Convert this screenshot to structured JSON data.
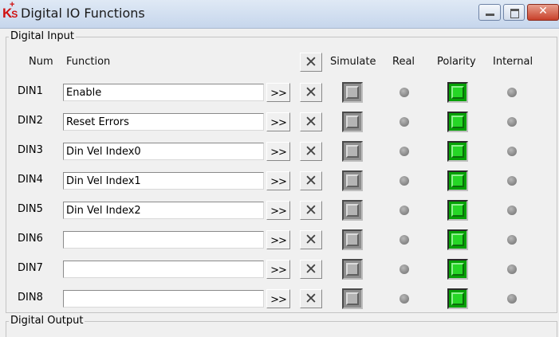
{
  "window": {
    "logo_text": "K",
    "title": "Digital IO Functions",
    "minimize_icon": "minimize-icon",
    "maximize_icon": "maximize-icon",
    "close_glyph": "✕"
  },
  "digital_input": {
    "legend": "Digital Input",
    "headers": {
      "num": "Num",
      "function": "Function",
      "clear_all_glyph": "✕",
      "simulate": "Simulate",
      "real": "Real",
      "polarity": "Polarity",
      "internal": "Internal"
    },
    "arrow_label": ">>",
    "clear_glyph": "✕",
    "rows": [
      {
        "num": "DIN1",
        "function": "Enable"
      },
      {
        "num": "DIN2",
        "function": "Reset Errors"
      },
      {
        "num": "DIN3",
        "function": "Din Vel Index0"
      },
      {
        "num": "DIN4",
        "function": "Din Vel Index1"
      },
      {
        "num": "DIN5",
        "function": "Din Vel Index2"
      },
      {
        "num": "DIN6",
        "function": ""
      },
      {
        "num": "DIN7",
        "function": ""
      },
      {
        "num": "DIN8",
        "function": ""
      }
    ],
    "colors": {
      "polarity_on": "#26d626",
      "led_off": "#7a7a7a",
      "simulate_off": "#b4b4b4"
    }
  },
  "digital_output": {
    "legend": "Digital Output"
  }
}
